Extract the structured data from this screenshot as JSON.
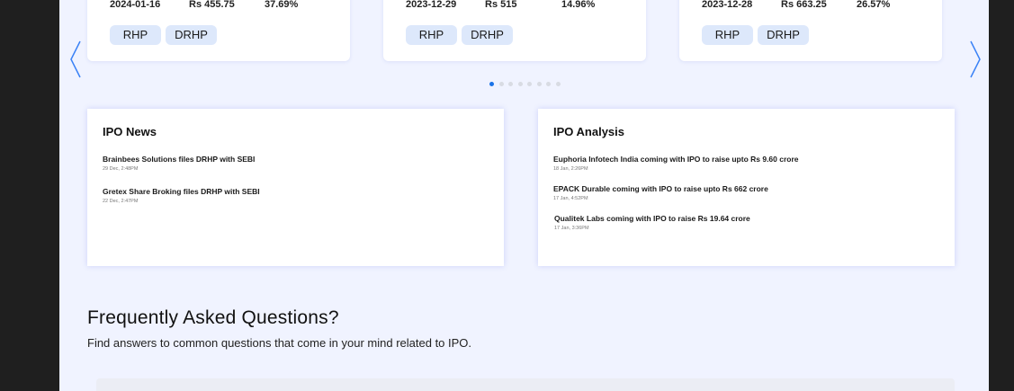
{
  "ipo_cards": [
    {
      "date": "2024-01-16",
      "price": "Rs 455.75",
      "gain": "37.69%",
      "rhp_label": "RHP",
      "drhp_label": "DRHP"
    },
    {
      "date": "2023-12-29",
      "price": "Rs 515",
      "gain": "14.96%",
      "rhp_label": "RHP",
      "drhp_label": "DRHP"
    },
    {
      "date": "2023-12-28",
      "price": "Rs 663.25",
      "gain": "26.57%",
      "rhp_label": "RHP",
      "drhp_label": "DRHP"
    }
  ],
  "carousel": {
    "prev_icon": "chevron-left-icon",
    "next_icon": "chevron-right-icon",
    "slide_count": 8,
    "active_index": 0
  },
  "ipo_news": {
    "title": "IPO News",
    "items": [
      {
        "headline": "Brainbees Solutions files DRHP with SEBI",
        "time": "29 Dec, 2:48PM"
      },
      {
        "headline": "Gretex Share Broking files DRHP with SEBI",
        "time": "22 Dec, 2:47PM"
      }
    ]
  },
  "ipo_analysis": {
    "title": "IPO Analysis",
    "items": [
      {
        "headline": "Euphoria Infotech India coming with IPO to raise upto Rs 9.60 crore",
        "time": "18 Jan, 2:26PM"
      },
      {
        "headline": "EPACK Durable coming with IPO to raise upto Rs 662 crore",
        "time": "17 Jan, 4:52PM"
      },
      {
        "headline": "Qualitek Labs coming with IPO to raise Rs 19.64 crore",
        "time": "17 Jan, 3:36PM"
      }
    ]
  },
  "faq": {
    "title": "Frequently Asked Questions?",
    "subtitle": "Find answers to common questions that come in your mind related to IPO."
  },
  "colors": {
    "accent": "#1a73e8",
    "page_bg": "#f0f3ff",
    "chip_bg": "#dde8fb"
  }
}
